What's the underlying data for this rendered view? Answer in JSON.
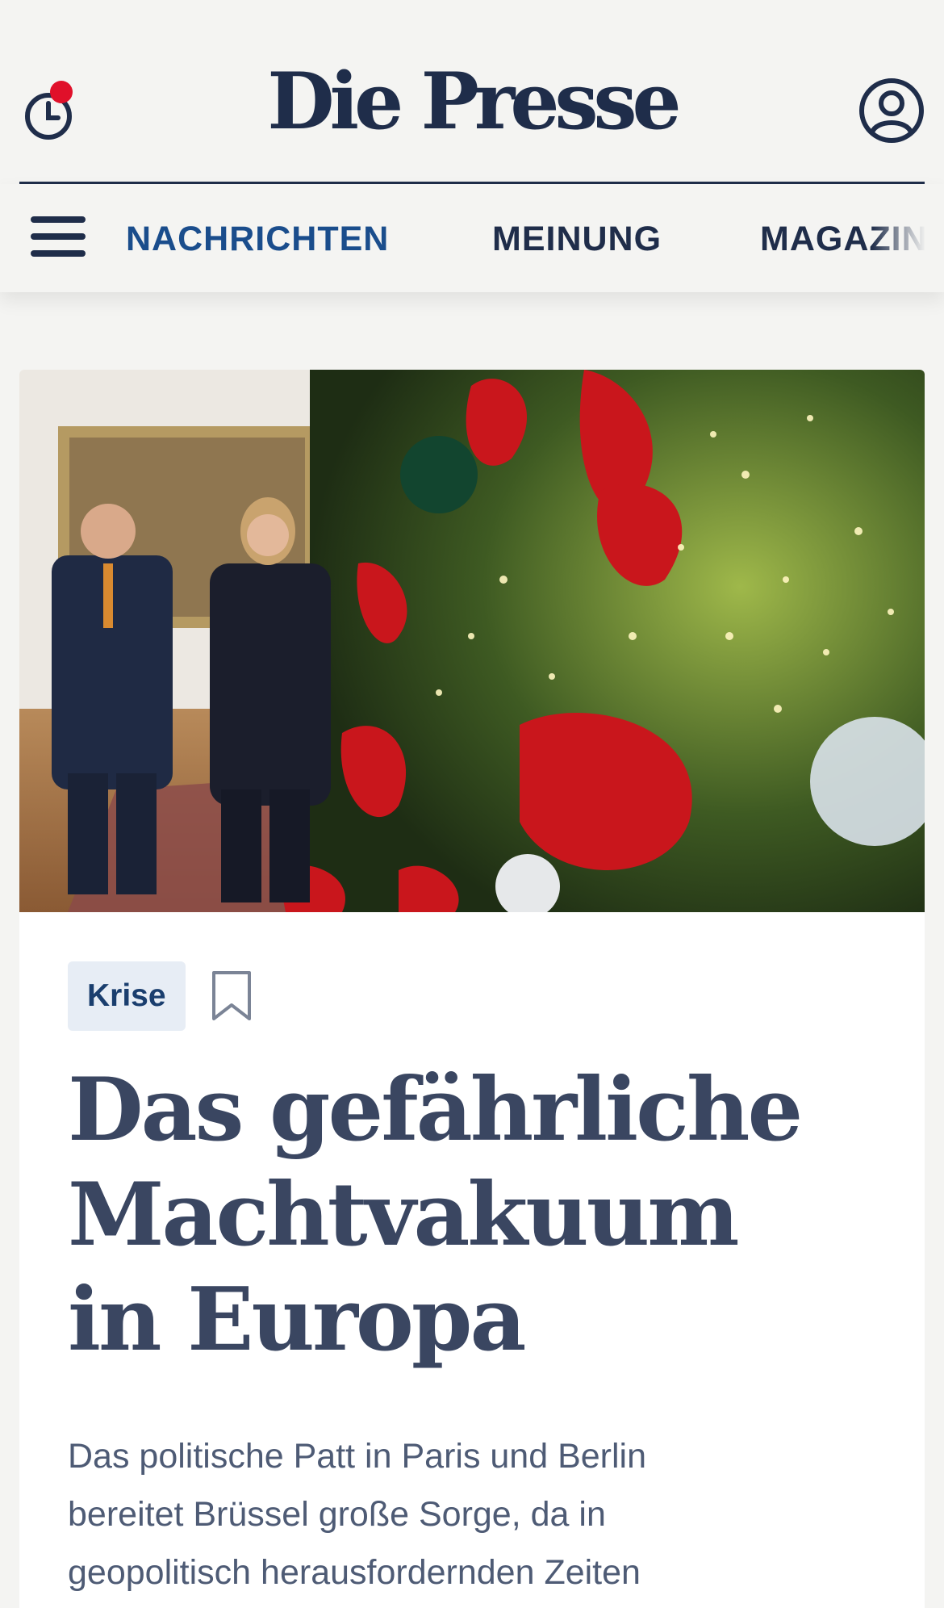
{
  "header": {
    "logo": "Die Presse",
    "history_icon": "history-clock-icon",
    "notification_color": "#e0102a",
    "profile_icon": "user-profile-icon",
    "brand_color": "#1f2d4a"
  },
  "nav": {
    "menu_icon": "hamburger-menu-icon",
    "items": [
      {
        "label": "NACHRICHTEN",
        "active": true
      },
      {
        "label": "MEINUNG",
        "active": false
      },
      {
        "label": "MAGAZIN",
        "active": false
      }
    ],
    "active_color": "#1a4d8c"
  },
  "article": {
    "image_alt": "Two politicians in a room next to a decorated Christmas tree",
    "tag": "Krise",
    "bookmark_icon": "bookmark-icon",
    "headline_lines": [
      "Das gefährliche",
      "Machtvakuum",
      "in Europa"
    ],
    "lead_lines": [
      "Das politische Patt in Paris und Berlin",
      "bereitet Brüssel große Sorge, da in",
      "geopolitisch herausfordernden Zeiten"
    ]
  }
}
